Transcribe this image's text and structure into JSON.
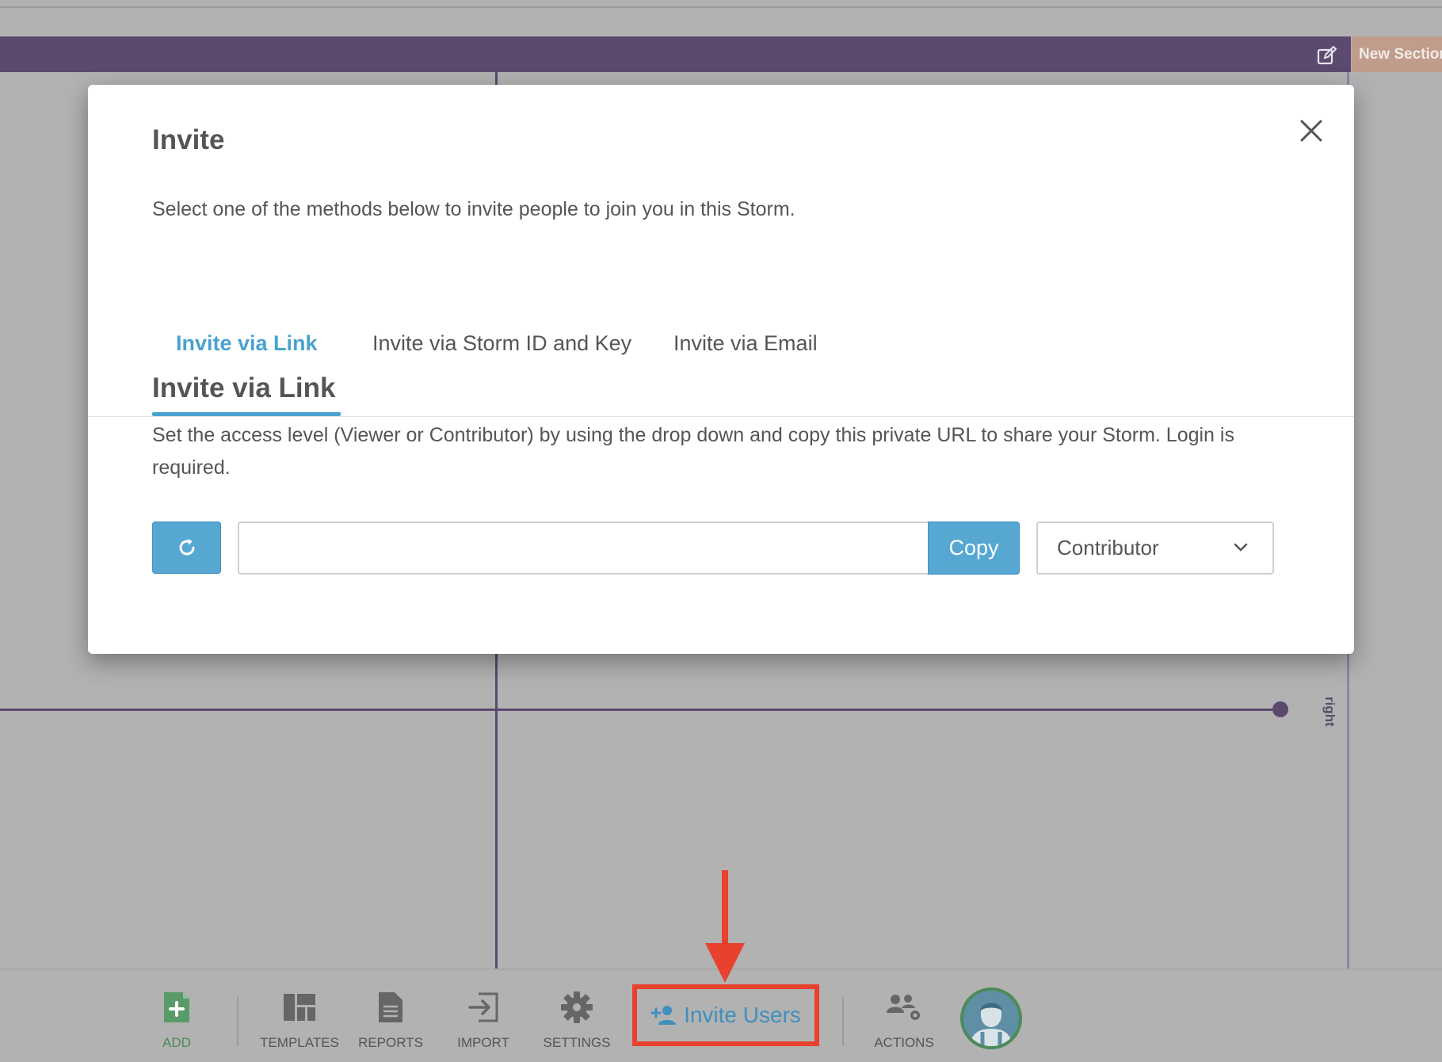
{
  "board": {
    "section_tab_label": "New Section",
    "axis_label_right": "right"
  },
  "modal": {
    "title": "Invite",
    "subtitle": "Select one of the methods below to invite people to join you in this Storm.",
    "tabs": [
      {
        "label": "Invite via Link",
        "active": true
      },
      {
        "label": "Invite via Storm ID and Key",
        "active": false
      },
      {
        "label": "Invite via Email",
        "active": false
      }
    ],
    "section_title": "Invite via Link",
    "section_description": "Set the access level (Viewer or Contributor) by using the drop down and copy this private URL to share your Storm. Login is required.",
    "url_value": "",
    "copy_label": "Copy",
    "access_level": "Contributor"
  },
  "toolbar": {
    "add_label": "ADD",
    "templates_label": "TEMPLATES",
    "reports_label": "REPORTS",
    "import_label": "IMPORT",
    "settings_label": "SETTINGS",
    "invite_label": "Invite Users",
    "actions_label": "ACTIONS"
  },
  "colors": {
    "accent_blue": "#4aa3cf",
    "board_purple": "#5b4a6e",
    "highlight_red": "#e8412e",
    "add_green": "#4a8a5a"
  }
}
